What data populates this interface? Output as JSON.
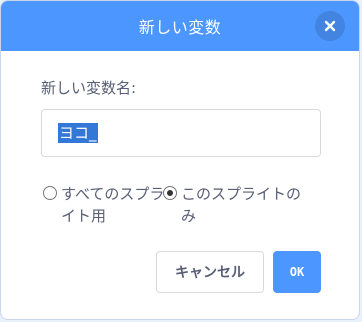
{
  "dialog": {
    "title": "新しい変数",
    "close_icon": "close-icon"
  },
  "form": {
    "name_label": "新しい変数名:",
    "name_value": "ヨコ_"
  },
  "scope": {
    "all_sprites_label": "すべてのスプライト用",
    "this_sprite_label": "このスプライトのみ",
    "selected": "this_sprite"
  },
  "buttons": {
    "cancel_label": "キャンセル",
    "ok_label": "OK"
  },
  "colors": {
    "accent": "#4c97ff",
    "text": "#575e75",
    "selection": "#3478d7"
  }
}
